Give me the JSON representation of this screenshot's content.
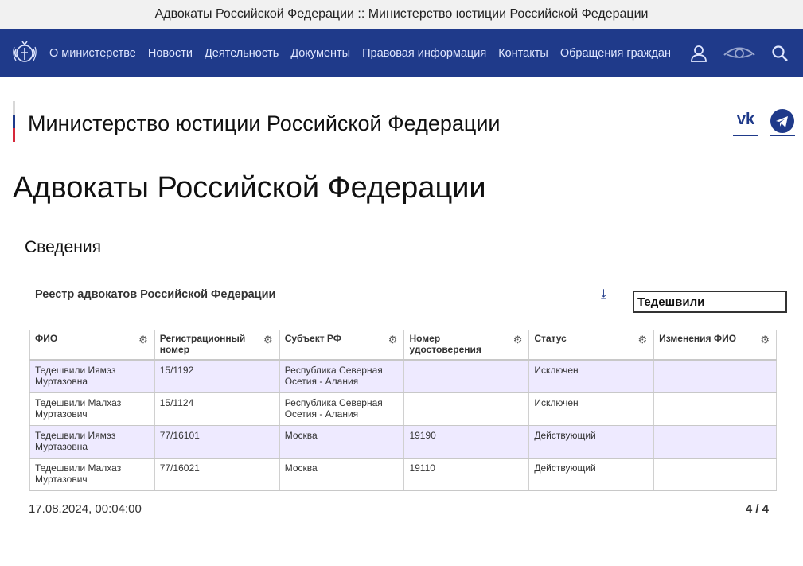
{
  "browser": {
    "tab_title": "Адвокаты Российской Федерации :: Министерство юстиции Российской Федерации"
  },
  "nav": {
    "items": [
      {
        "label": "О министерстве"
      },
      {
        "label": "Новости"
      },
      {
        "label": "Деятельность"
      },
      {
        "label": "Документы"
      },
      {
        "label": "Правовая информация"
      },
      {
        "label": "Контакты"
      },
      {
        "label": "Обращения граждан"
      }
    ],
    "icons": [
      "user-icon",
      "eye-icon",
      "search-icon"
    ],
    "color": "#1f3a8a"
  },
  "header": {
    "site_title": "Министерство юстиции Российской Федерации",
    "social": [
      "vk-icon",
      "telegram-icon"
    ]
  },
  "page": {
    "title": "Адвокаты Российской Федерации",
    "section": "Сведения"
  },
  "registry": {
    "title": "Реестр адвокатов Российской Федерации",
    "download_icon": "⤓",
    "search_value": "Тедешвили",
    "columns": [
      {
        "label": "ФИО"
      },
      {
        "label": "Регистрационный номер"
      },
      {
        "label": "Субъект РФ"
      },
      {
        "label": "Номер удостоверения"
      },
      {
        "label": "Статус"
      },
      {
        "label": "Изменения ФИО"
      }
    ],
    "rows": [
      {
        "cells": [
          "Тедешвили Иямэз Муртазовна",
          "15/1192",
          "Республика Северная Осетия - Алания",
          "",
          "Исключен",
          ""
        ]
      },
      {
        "cells": [
          "Тедешвили Малхаз Муртазович",
          "15/1124",
          "Республика Северная Осетия - Алания",
          "",
          "Исключен",
          ""
        ]
      },
      {
        "cells": [
          "Тедешвили Иямэз Муртазовна",
          "77/16101",
          "Москва",
          "19190",
          "Действующий",
          ""
        ]
      },
      {
        "cells": [
          "Тедешвили Малхаз Муртазович",
          "77/16021",
          "Москва",
          "19110",
          "Действующий",
          ""
        ]
      }
    ],
    "row_highlight_color": "#eeeaff",
    "timestamp": "17.08.2024, 00:04:00",
    "pagination": "4 / 4"
  }
}
